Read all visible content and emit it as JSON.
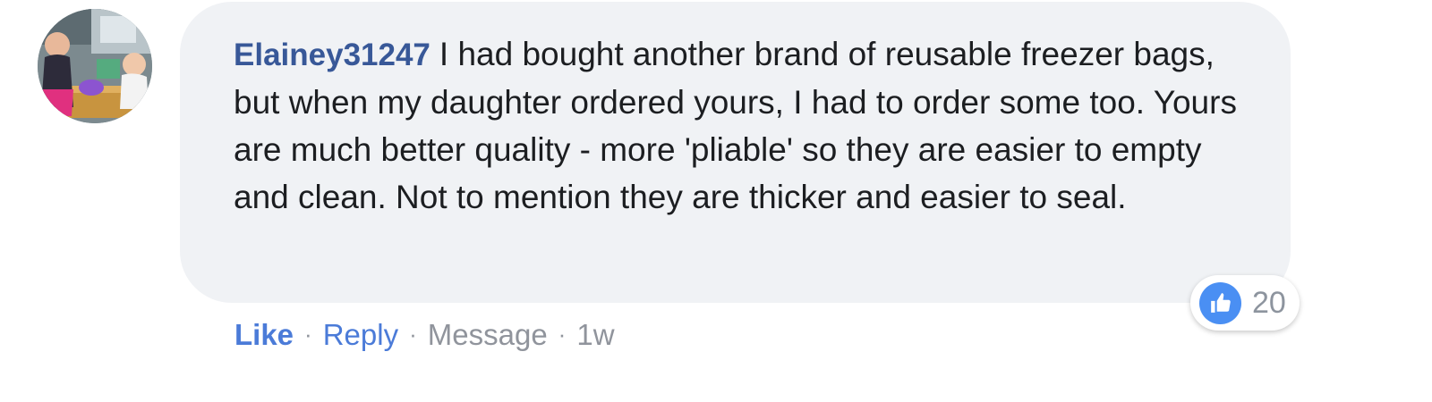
{
  "comment": {
    "author": "Elainey31247",
    "text": "I had bought another brand of reusable freezer bags, but when my daughter ordered yours, I had to order some too. Yours are much better quality - more 'pliable' so they are easier to empty and clean. Not to mention they are thicker and easier to seal.",
    "avatar_icon": "user-photo-avatar"
  },
  "reactions": {
    "icon": "thumbs-up-icon",
    "count": "20",
    "color": "#4a8ff3"
  },
  "actions": {
    "like": "Like",
    "reply": "Reply",
    "message": "Message",
    "separator": "·",
    "timestamp": "1w"
  },
  "colors": {
    "author": "#385898",
    "bubble": "#f0f2f5",
    "link": "#4b7bd8",
    "muted": "#90949c"
  }
}
